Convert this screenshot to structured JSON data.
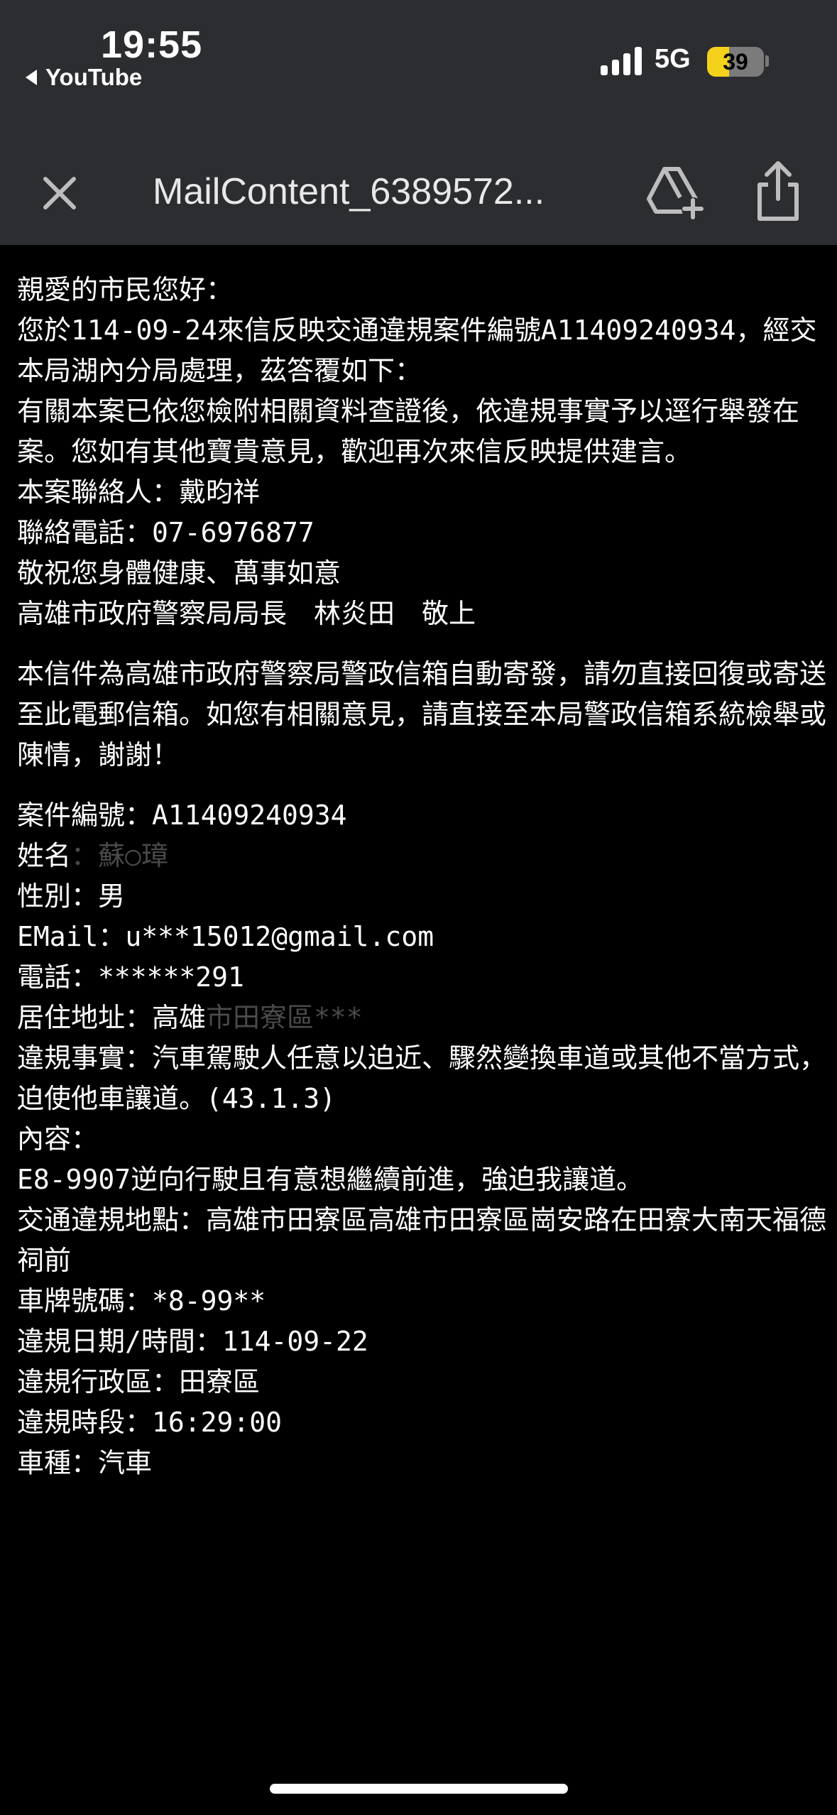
{
  "status_bar": {
    "time": "19:55",
    "back_app": "YouTube",
    "network": "5G",
    "battery_level": "39",
    "battery_fraction": 0.39
  },
  "toolbar": {
    "title": "MailContent_6389572...",
    "icons": [
      "close-icon",
      "add-to-drive-icon",
      "share-icon"
    ]
  },
  "mail": {
    "greeting": "親愛的市民您好：",
    "body_line_1": "您於114-09-24來信反映交通違規案件編號A11409240934，經交本局湖內分局處理，茲答覆如下：",
    "body_line_2": "有關本案已依您檢附相關資料查證後，依違規事實予以逕行舉發在案。您如有其他寶貴意見，歡迎再次來信反映提供建言。",
    "contact_person": "本案聯絡人：戴昀祥",
    "contact_phone": "聯絡電話：07-6976877",
    "closing": "敬祝您身體健康、萬事如意",
    "signature": "高雄市政府警察局局長　林炎田　敬上",
    "notice": "本信件為高雄市政府警察局警政信箱自動寄發，請勿直接回復或寄送至此電郵信箱。如您有相關意見，請直接至本局警政信箱系統檢舉或陳情，謝謝！",
    "case_no": "案件編號：A11409240934",
    "name_label": "姓名",
    "name_value": "：蘇○璋",
    "gender": "性別：男",
    "email": "EMail：u***15012@gmail.com",
    "phone": "電話：******291",
    "address_label": "居住地址：高雄",
    "address_value": "市田寮區***",
    "violation_fact": "違規事實：汽車駕駛人任意以迫近、驟然變換車道或其他不當方式，迫使他車讓道。(43.1.3)",
    "content_label": "內容：",
    "content_text": "E8-9907逆向行駛且有意想繼續前進，強迫我讓道。",
    "location": "交通違規地點：高雄市田寮區高雄市田寮區崗安路在田寮大南天福德祠前",
    "plate": "車牌號碼：*8-99**",
    "date": "違規日期/時間：114-09-22",
    "district": "違規行政區：田寮區",
    "time_slot": "違規時段：16:29:00",
    "vehicle_type": "車種：汽車"
  }
}
